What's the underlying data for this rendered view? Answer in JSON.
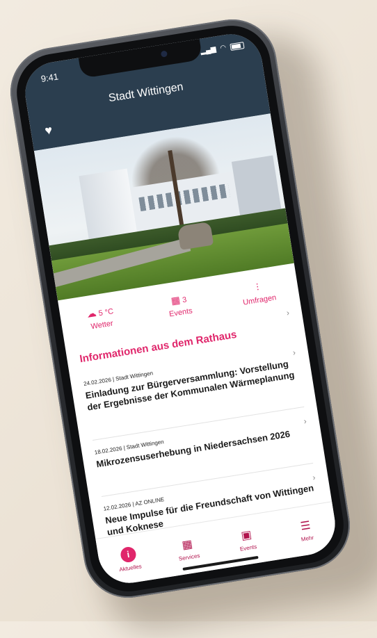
{
  "status_bar": {
    "time": "9:41"
  },
  "header": {
    "title": "Stadt Wittingen"
  },
  "stats": [
    {
      "icon": "cloud-icon",
      "value": "5 °C",
      "label": "Wetter"
    },
    {
      "icon": "calendar-icon",
      "value": "3",
      "label": "Events"
    },
    {
      "icon": "poll-icon",
      "value": "",
      "label": "Umfragen"
    }
  ],
  "section": {
    "title": "Informationen aus dem Rathaus"
  },
  "news": [
    {
      "date": "24.02.2026",
      "source": "Stadt Wittingen",
      "title": "Einladung zur Bürgerversammlung: Vorstellung der Ergebnisse der Kommunalen Wärmeplanung"
    },
    {
      "date": "18.02.2026",
      "source": "Stadt Wittingen",
      "title": "Mikrozensuserhebung in Niedersachsen 2026"
    },
    {
      "date": "12.02.2026",
      "source": "AZ ONLINE",
      "title": "Neue Impulse für die Freundschaft von Wittingen und Koknese"
    }
  ],
  "tabs": [
    {
      "label": "Aktuelles",
      "icon": "info-icon"
    },
    {
      "label": "Services",
      "icon": "grid-icon"
    },
    {
      "label": "Events",
      "icon": "calendar-icon"
    },
    {
      "label": "Mehr",
      "icon": "menu-icon"
    }
  ],
  "colors": {
    "accent": "#e0266b",
    "header": "#2b3e4f"
  }
}
